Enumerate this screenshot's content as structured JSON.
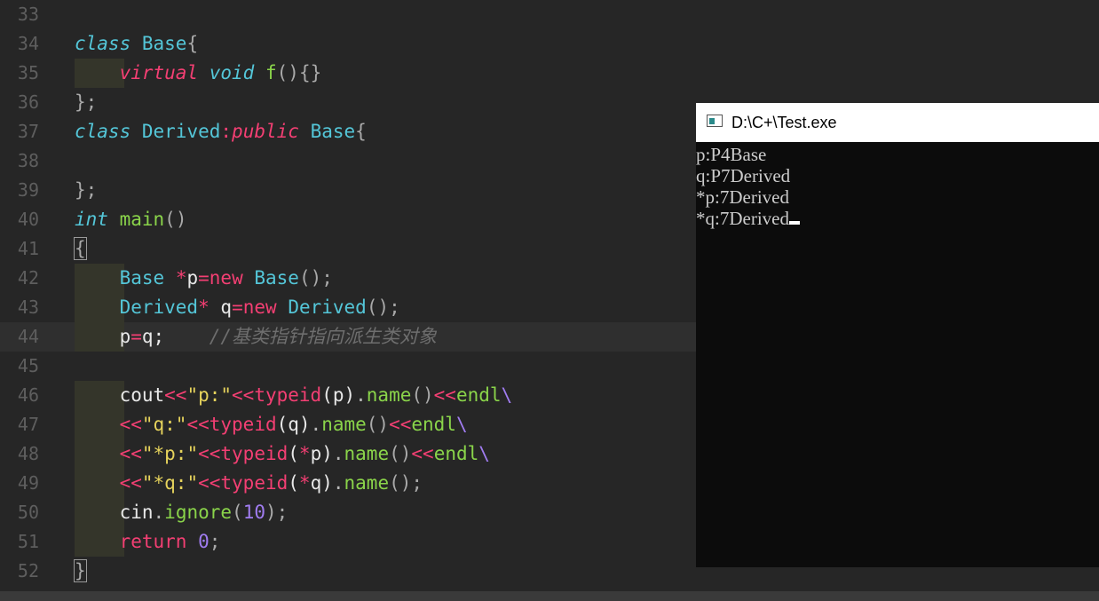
{
  "editor": {
    "line_numbers": [
      "33",
      "34",
      "35",
      "36",
      "37",
      "38",
      "39",
      "40",
      "41",
      "42",
      "43",
      "44",
      "45",
      "46",
      "47",
      "48",
      "49",
      "50",
      "51",
      "52"
    ],
    "lines": {
      "l34": {
        "kw_class": "class",
        "type_base": "Base",
        "brace": "{"
      },
      "l35": {
        "kw_virtual": "virtual",
        "kw_void": "void",
        "fn_f": "f",
        "parens": "()",
        "braces": "{}"
      },
      "l36": {
        "close": "};"
      },
      "l37": {
        "kw_class": "class",
        "type_derived": "Derived",
        "colon": ":",
        "kw_public": "public",
        "type_base": "Base",
        "brace": "{"
      },
      "l39": {
        "close": "};"
      },
      "l40": {
        "kw_int": "int",
        "fn_main": "main",
        "parens": "()"
      },
      "l41": {
        "brace": "{"
      },
      "l42": {
        "type": "Base",
        "star": "*",
        "var": "p",
        "eq": "=",
        "kw_new": "new",
        "type2": "Base",
        "call": "();"
      },
      "l43": {
        "type": "Derived",
        "star": "*",
        "var": "q",
        "eq": "=",
        "kw_new": "new",
        "type2": "Derived",
        "call": "();"
      },
      "l44": {
        "p": "p",
        "eq": "=",
        "q": "q;",
        "comment": "//基类指针指向派生类对象"
      },
      "l46": {
        "cout": "cout",
        "op1": "<<",
        "str": "\"p:\"",
        "op2": "<<",
        "typeid": "typeid",
        "arg": "(p)",
        "dot": ".",
        "name": "name",
        "parens": "()",
        "op3": "<<",
        "endl": "endl",
        "bs": "\\"
      },
      "l47": {
        "op1": "<<",
        "str": "\"q:\"",
        "op2": "<<",
        "typeid": "typeid",
        "arg": "(q)",
        "dot": ".",
        "name": "name",
        "parens": "()",
        "op3": "<<",
        "endl": "endl",
        "bs": "\\"
      },
      "l48": {
        "op1": "<<",
        "str": "\"*p:\"",
        "op2": "<<",
        "typeid": "typeid",
        "lp": "(",
        "star": "*",
        "arg": "p)",
        "dot": ".",
        "name": "name",
        "parens": "()",
        "op3": "<<",
        "endl": "endl",
        "bs": "\\"
      },
      "l49": {
        "op1": "<<",
        "str": "\"*q:\"",
        "op2": "<<",
        "typeid": "typeid",
        "lp": "(",
        "star": "*",
        "arg": "q)",
        "dot": ".",
        "name": "name",
        "parens": "();"
      },
      "l50": {
        "cin": "cin",
        "dot": ".",
        "ignore": "ignore",
        "lp": "(",
        "num": "10",
        "rp": ");"
      },
      "l51": {
        "kw_return": "return",
        "num": "0",
        "semi": ";"
      },
      "l52": {
        "brace": "}"
      }
    }
  },
  "console": {
    "title": "D:\\C+\\Test.exe",
    "output": [
      "p:P4Base",
      "q:P7Derived",
      "*p:7Derived",
      "*q:7Derived"
    ]
  },
  "colors": {
    "editor_bg": "#262626",
    "keyword": "#f33f73",
    "type": "#54c6d8",
    "function": "#8ad44a",
    "string": "#e6d35c",
    "number": "#a07cf0",
    "comment": "#6e6e6e",
    "console_bg": "#0c0c0c"
  }
}
